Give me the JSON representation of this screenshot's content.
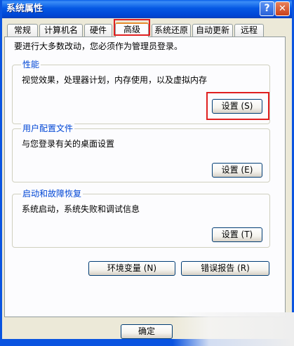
{
  "window": {
    "title": "系统属性",
    "help_label": "?",
    "close_label": "✕"
  },
  "tabs": [
    {
      "label": "常规"
    },
    {
      "label": "计算机名"
    },
    {
      "label": "硬件"
    },
    {
      "label": "高级",
      "active": true
    },
    {
      "label": "系统还原"
    },
    {
      "label": "自动更新"
    },
    {
      "label": "远程"
    }
  ],
  "intro": "要进行大多数改动，您必须作为管理员登录。",
  "groups": {
    "performance": {
      "label": "性能",
      "description": "视觉效果，处理器计划，内存使用，以及虚拟内存",
      "button": "设置 (S)"
    },
    "user_profiles": {
      "label": "用户配置文件",
      "description": "与您登录有关的桌面设置",
      "button": "设置 (E)"
    },
    "startup_recovery": {
      "label": "启动和故障恢复",
      "description": "系统启动，系统失败和调试信息",
      "button": "设置 (T)"
    }
  },
  "buttons": {
    "env_vars": "环境变量 (N)",
    "error_report": "错误报告 (R)",
    "ok": "确定"
  },
  "colors": {
    "titlebar": "#0a54e0",
    "highlight": "#e02020",
    "group_label": "#0046d5"
  }
}
